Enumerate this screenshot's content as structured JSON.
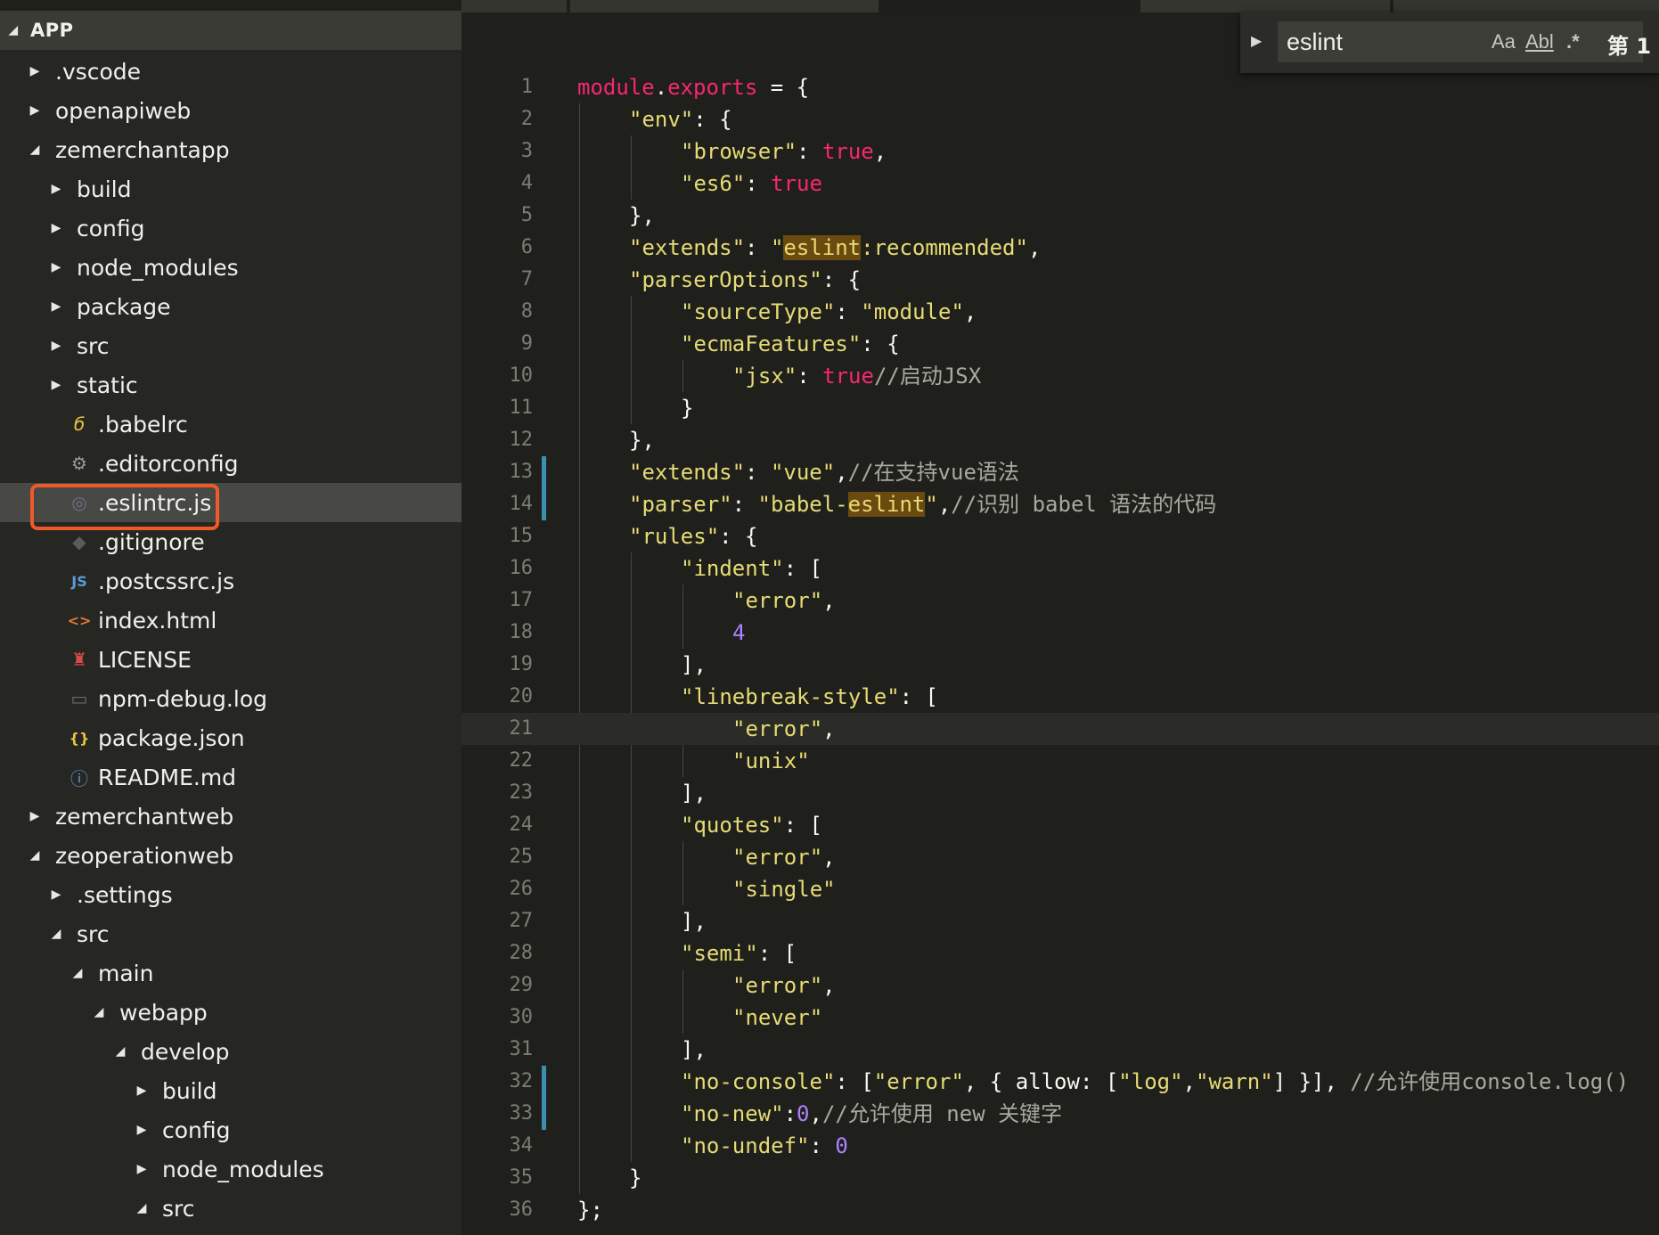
{
  "explorer": {
    "root_label": "APP",
    "items": [
      {
        "label": ".vscode",
        "depth": 1,
        "kind": "folder",
        "expanded": false
      },
      {
        "label": "openapiweb",
        "depth": 1,
        "kind": "folder",
        "expanded": false
      },
      {
        "label": "zemerchantapp",
        "depth": 1,
        "kind": "folder",
        "expanded": true
      },
      {
        "label": "build",
        "depth": 2,
        "kind": "folder",
        "expanded": false
      },
      {
        "label": "config",
        "depth": 2,
        "kind": "folder",
        "expanded": false
      },
      {
        "label": "node_modules",
        "depth": 2,
        "kind": "folder",
        "expanded": false
      },
      {
        "label": "package",
        "depth": 2,
        "kind": "folder",
        "expanded": false
      },
      {
        "label": "src",
        "depth": 2,
        "kind": "folder",
        "expanded": false
      },
      {
        "label": "static",
        "depth": 2,
        "kind": "folder",
        "expanded": false
      },
      {
        "label": ".babelrc",
        "depth": 2,
        "kind": "file",
        "icon": "babel-icon"
      },
      {
        "label": ".editorconfig",
        "depth": 2,
        "kind": "file",
        "icon": "gear-icon"
      },
      {
        "label": ".eslintrc.js",
        "depth": 2,
        "kind": "file",
        "icon": "eslint-icon",
        "selected": true
      },
      {
        "label": ".gitignore",
        "depth": 2,
        "kind": "file",
        "icon": "git-icon"
      },
      {
        "label": ".postcssrc.js",
        "depth": 2,
        "kind": "file",
        "icon": "js-icon"
      },
      {
        "label": "index.html",
        "depth": 2,
        "kind": "file",
        "icon": "html-icon"
      },
      {
        "label": "LICENSE",
        "depth": 2,
        "kind": "file",
        "icon": "license-icon"
      },
      {
        "label": "npm-debug.log",
        "depth": 2,
        "kind": "file",
        "icon": "log-icon"
      },
      {
        "label": "package.json",
        "depth": 2,
        "kind": "file",
        "icon": "json-icon"
      },
      {
        "label": "README.md",
        "depth": 2,
        "kind": "file",
        "icon": "info-icon"
      },
      {
        "label": "zemerchantweb",
        "depth": 1,
        "kind": "folder",
        "expanded": false
      },
      {
        "label": "zeoperationweb",
        "depth": 1,
        "kind": "folder",
        "expanded": true
      },
      {
        "label": ".settings",
        "depth": 2,
        "kind": "folder",
        "expanded": false
      },
      {
        "label": "src",
        "depth": 2,
        "kind": "folder",
        "expanded": true
      },
      {
        "label": "main",
        "depth": 3,
        "kind": "folder",
        "expanded": true
      },
      {
        "label": "webapp",
        "depth": 4,
        "kind": "folder",
        "expanded": true
      },
      {
        "label": "develop",
        "depth": 5,
        "kind": "folder",
        "expanded": true
      },
      {
        "label": "build",
        "depth": 6,
        "kind": "folder",
        "expanded": false
      },
      {
        "label": "config",
        "depth": 6,
        "kind": "folder",
        "expanded": false
      },
      {
        "label": "node_modules",
        "depth": 6,
        "kind": "folder",
        "expanded": false
      },
      {
        "label": "src",
        "depth": 6,
        "kind": "folder",
        "expanded": true
      }
    ]
  },
  "find_widget": {
    "query": "eslint",
    "match_case_label": "Aa",
    "whole_word_label": "Abl",
    "regex_label": ".*",
    "result_count": "第 1 ^"
  },
  "editor": {
    "current_line": 21,
    "modified_lines": [
      13,
      14,
      32,
      33
    ],
    "lines": [
      {
        "n": "1",
        "indent": 0,
        "tokens": [
          [
            "k",
            "module"
          ],
          [
            "p",
            "."
          ],
          [
            "k",
            "exports"
          ],
          [
            "p",
            " = {"
          ]
        ]
      },
      {
        "n": "2",
        "indent": 1,
        "tokens": [
          [
            "s",
            "\"env\""
          ],
          [
            "p",
            ": {"
          ]
        ]
      },
      {
        "n": "3",
        "indent": 2,
        "tokens": [
          [
            "s",
            "\"browser\""
          ],
          [
            "p",
            ": "
          ],
          [
            "k",
            "true"
          ],
          [
            "p",
            ","
          ]
        ]
      },
      {
        "n": "4",
        "indent": 2,
        "tokens": [
          [
            "s",
            "\"es6\""
          ],
          [
            "p",
            ": "
          ],
          [
            "k",
            "true"
          ]
        ]
      },
      {
        "n": "5",
        "indent": 1,
        "tokens": [
          [
            "p",
            "},"
          ]
        ]
      },
      {
        "n": "6",
        "indent": 1,
        "tokens": [
          [
            "s",
            "\"extends\""
          ],
          [
            "p",
            ": "
          ],
          [
            "s",
            "\""
          ],
          [
            "h",
            "eslint"
          ],
          [
            "s",
            ":recommended\""
          ],
          [
            "p",
            ","
          ]
        ]
      },
      {
        "n": "7",
        "indent": 1,
        "tokens": [
          [
            "s",
            "\"parserOptions\""
          ],
          [
            "p",
            ": {"
          ]
        ]
      },
      {
        "n": "8",
        "indent": 2,
        "tokens": [
          [
            "s",
            "\"sourceType\""
          ],
          [
            "p",
            ": "
          ],
          [
            "s",
            "\"module\""
          ],
          [
            "p",
            ","
          ]
        ]
      },
      {
        "n": "9",
        "indent": 2,
        "tokens": [
          [
            "s",
            "\"ecmaFeatures\""
          ],
          [
            "p",
            ": {"
          ]
        ]
      },
      {
        "n": "10",
        "indent": 3,
        "tokens": [
          [
            "s",
            "\"jsx\""
          ],
          [
            "p",
            ": "
          ],
          [
            "k",
            "true"
          ],
          [
            "c",
            "//启动JSX"
          ]
        ]
      },
      {
        "n": "11",
        "indent": 2,
        "tokens": [
          [
            "p",
            "}"
          ]
        ]
      },
      {
        "n": "12",
        "indent": 1,
        "tokens": [
          [
            "p",
            "},"
          ]
        ]
      },
      {
        "n": "13",
        "indent": 1,
        "tokens": [
          [
            "s",
            "\"extends\""
          ],
          [
            "p",
            ": "
          ],
          [
            "s",
            "\"vue\""
          ],
          [
            "p",
            ","
          ],
          [
            "c",
            "//在支持vue语法"
          ]
        ]
      },
      {
        "n": "14",
        "indent": 1,
        "tokens": [
          [
            "s",
            "\"parser\""
          ],
          [
            "p",
            ": "
          ],
          [
            "s",
            "\"babel-"
          ],
          [
            "h",
            "eslint"
          ],
          [
            "s",
            "\""
          ],
          [
            "p",
            ","
          ],
          [
            "c",
            "//识别 babel 语法的代码"
          ]
        ]
      },
      {
        "n": "15",
        "indent": 1,
        "tokens": [
          [
            "s",
            "\"rules\""
          ],
          [
            "p",
            ": {"
          ]
        ]
      },
      {
        "n": "16",
        "indent": 2,
        "tokens": [
          [
            "s",
            "\"indent\""
          ],
          [
            "p",
            ": ["
          ]
        ]
      },
      {
        "n": "17",
        "indent": 3,
        "tokens": [
          [
            "s",
            "\"error\""
          ],
          [
            "p",
            ","
          ]
        ]
      },
      {
        "n": "18",
        "indent": 3,
        "tokens": [
          [
            "n",
            "4"
          ]
        ]
      },
      {
        "n": "19",
        "indent": 2,
        "tokens": [
          [
            "p",
            "],"
          ]
        ]
      },
      {
        "n": "20",
        "indent": 2,
        "tokens": [
          [
            "s",
            "\"linebreak-style\""
          ],
          [
            "p",
            ": ["
          ]
        ]
      },
      {
        "n": "21",
        "indent": 3,
        "tokens": [
          [
            "s",
            "\"error\""
          ],
          [
            "p",
            ","
          ]
        ]
      },
      {
        "n": "22",
        "indent": 3,
        "tokens": [
          [
            "s",
            "\"unix\""
          ]
        ]
      },
      {
        "n": "23",
        "indent": 2,
        "tokens": [
          [
            "p",
            "],"
          ]
        ]
      },
      {
        "n": "24",
        "indent": 2,
        "tokens": [
          [
            "s",
            "\"quotes\""
          ],
          [
            "p",
            ": ["
          ]
        ]
      },
      {
        "n": "25",
        "indent": 3,
        "tokens": [
          [
            "s",
            "\"error\""
          ],
          [
            "p",
            ","
          ]
        ]
      },
      {
        "n": "26",
        "indent": 3,
        "tokens": [
          [
            "s",
            "\"single\""
          ]
        ]
      },
      {
        "n": "27",
        "indent": 2,
        "tokens": [
          [
            "p",
            "],"
          ]
        ]
      },
      {
        "n": "28",
        "indent": 2,
        "tokens": [
          [
            "s",
            "\"semi\""
          ],
          [
            "p",
            ": ["
          ]
        ]
      },
      {
        "n": "29",
        "indent": 3,
        "tokens": [
          [
            "s",
            "\"error\""
          ],
          [
            "p",
            ","
          ]
        ]
      },
      {
        "n": "30",
        "indent": 3,
        "tokens": [
          [
            "s",
            "\"never\""
          ]
        ]
      },
      {
        "n": "31",
        "indent": 2,
        "tokens": [
          [
            "p",
            "],"
          ]
        ]
      },
      {
        "n": "32",
        "indent": 2,
        "tokens": [
          [
            "s",
            "\"no-console\""
          ],
          [
            "p",
            ": ["
          ],
          [
            "s",
            "\"error\""
          ],
          [
            "p",
            ", { allow: ["
          ],
          [
            "s",
            "\"log\""
          ],
          [
            "p",
            ","
          ],
          [
            "s",
            "\"warn\""
          ],
          [
            "p",
            "] }], "
          ],
          [
            "c",
            "//允许使用console.log()"
          ]
        ]
      },
      {
        "n": "33",
        "indent": 2,
        "tokens": [
          [
            "s",
            "\"no-new\""
          ],
          [
            "p",
            ":"
          ],
          [
            "n",
            "0"
          ],
          [
            "p",
            ","
          ],
          [
            "c",
            "//允许使用 new 关键字"
          ]
        ]
      },
      {
        "n": "34",
        "indent": 2,
        "tokens": [
          [
            "s",
            "\"no-undef\""
          ],
          [
            "p",
            ": "
          ],
          [
            "n",
            "0"
          ]
        ]
      },
      {
        "n": "35",
        "indent": 1,
        "tokens": [
          [
            "p",
            "}"
          ]
        ]
      },
      {
        "n": "36",
        "indent": 0,
        "tokens": [
          [
            "p",
            "};"
          ]
        ]
      }
    ]
  },
  "colors": {
    "keyword": "#f92672",
    "string": "#e6db74",
    "number": "#ae81ff",
    "comment": "#a9a99e",
    "match_highlight": "#6b4a10",
    "selection_outline": "#ef5a2a",
    "modified_gutter": "#3c8fb0"
  }
}
